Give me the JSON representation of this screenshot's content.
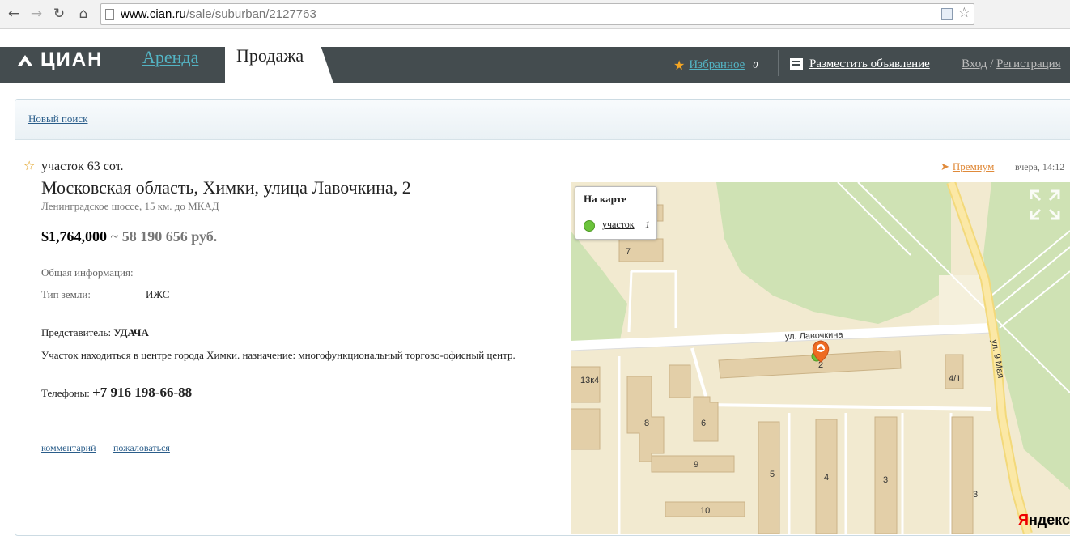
{
  "browser": {
    "url_host": "www.cian.ru",
    "url_path": "/sale/suburban/2127763",
    "icons": [
      "back-icon",
      "forward-icon",
      "reload-icon",
      "home-icon",
      "page-icon",
      "bookmark-star-icon"
    ]
  },
  "header": {
    "logo_text": "ЦИАН",
    "tab_rent": "Аренда",
    "tab_sale": "Продажа",
    "favorites_label": "Избранное",
    "favorites_count": "0",
    "post_ad": "Разместить объявление",
    "login": "Вход",
    "login_sep": " / ",
    "register": "Регистрация"
  },
  "search": {
    "new_search": "Новый поиск"
  },
  "listing": {
    "type": "участок 63 сот.",
    "address": "Московская область, Химки, улица Лавочкина, 2",
    "highway": "Ленинградское шоссе, 15 км. до МКАД",
    "price_usd": "$1,764,000",
    "price_tilde": " ~ ",
    "price_rub": "58 190 656 руб.",
    "general_info_label": "Общая информация:",
    "land_type_label": "Тип земли:",
    "land_type_value": "ИЖС",
    "agent_label": "Представитель: ",
    "agent_name": "УДАЧА",
    "description": "Участок находиться в центре города Химки. назначение: многофункциональный торгово-офисный центр.",
    "phones_label": "Телефоны: ",
    "phone": "+7 916 198-66-88",
    "comment_link": "комментарий",
    "complain_link": "пожаловаться",
    "premium": "Премиум",
    "published": "вчера, 14:12"
  },
  "map": {
    "legend_title": "На карте",
    "legend_item": "участок",
    "legend_count": "1",
    "street_main": "ул. Лавочкина",
    "street_side": "ул. 9 Мая",
    "building_labels": [
      "7",
      "13к4",
      "8",
      "6",
      "9",
      "10",
      "5",
      "4",
      "3",
      "3",
      "4/1",
      "2"
    ],
    "attribution_y": "Я",
    "attribution_rest": "ндекс"
  }
}
